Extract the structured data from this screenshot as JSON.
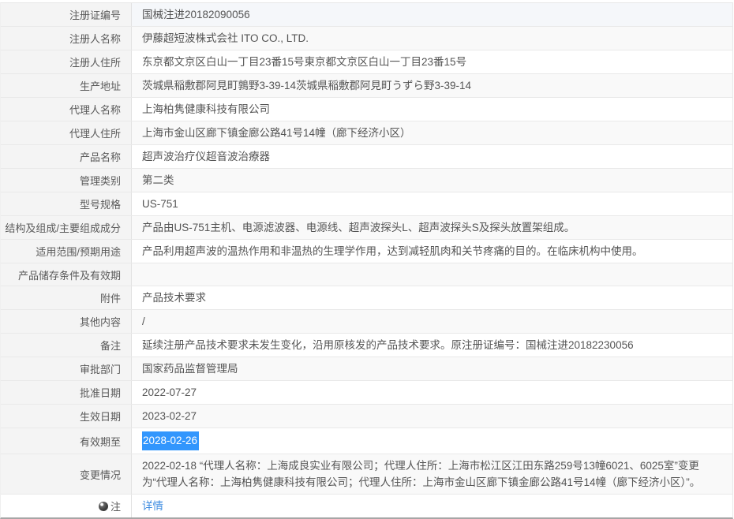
{
  "table": {
    "rows": [
      {
        "label": "注册证编号",
        "value": "国械注进20182090056"
      },
      {
        "label": "注册人名称",
        "value": "伊藤超短波株式会社 ITO CO., LTD."
      },
      {
        "label": "注册人住所",
        "value": "东京都文京区白山一丁目23番15号東京都文京区白山一丁目23番15号"
      },
      {
        "label": "生产地址",
        "value": "茨城県稲敷郡阿見町鶉野3-39-14茨城県稲敷郡阿見町うずら野3-39-14"
      },
      {
        "label": "代理人名称",
        "value": "上海柏隽健康科技有限公司"
      },
      {
        "label": "代理人住所",
        "value": "上海市金山区廊下镇金廊公路41号14幢（廊下经济小区）"
      },
      {
        "label": "产品名称",
        "value": "超声波治疗仪超音波治療器"
      },
      {
        "label": "管理类别",
        "value": "第二类"
      },
      {
        "label": "型号规格",
        "value": "US-751"
      },
      {
        "label": "结构及组成/主要组成成分",
        "value": "产品由US-751主机、电源滤波器、电源线、超声波探头L、超声波探头S及探头放置架组成。"
      },
      {
        "label": "适用范围/预期用途",
        "value": "产品利用超声波的温热作用和非温热的生理学作用，达到减轻肌肉和关节疼痛的目的。在临床机构中使用。"
      },
      {
        "label": "产品储存条件及有效期",
        "value": ""
      },
      {
        "label": "附件",
        "value": "产品技术要求"
      },
      {
        "label": "其他内容",
        "value": "/"
      },
      {
        "label": "备注",
        "value": "延续注册产品技术要求未发生变化，沿用原核发的产品技术要求。原注册证编号：国械注进20182230056"
      },
      {
        "label": "审批部门",
        "value": "国家药品监督管理局"
      },
      {
        "label": "批准日期",
        "value": "2022-07-27"
      },
      {
        "label": "生效日期",
        "value": "2023-02-27"
      },
      {
        "label": "有效期至",
        "value": "2028-02-26",
        "selected": true
      },
      {
        "label": "变更情况",
        "value": "2022-02-18 “代理人名称：上海成良实业有限公司；代理人住所：上海市松江区江田东路259号13幢6021、6025室”变更为“代理人名称：上海柏隽健康科技有限公司；代理人住所：上海市金山区廊下镇金廊公路41号14幢（廊下经济小区）”。"
      },
      {
        "label": "注",
        "value": "详情",
        "icon": "note-dot-icon",
        "link": true
      }
    ],
    "colors": {
      "link_blue": "#3c8be0",
      "selection_blue": "#3296fd",
      "label_bg": "#f4f4f4",
      "stripe_bg": "#f9f9f9",
      "first_row_bg": "#f5f7fa",
      "row_border": "#e9e9e9",
      "bottom_border": "#a6a6a6",
      "text": "#545454"
    }
  }
}
